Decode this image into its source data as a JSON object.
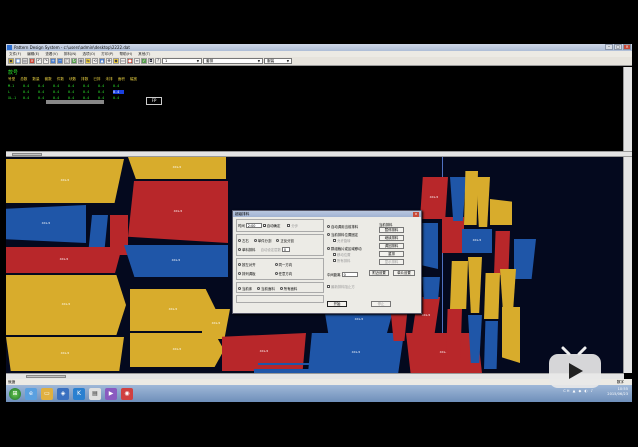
{
  "window": {
    "title": "Pattern Design System - c:\\users\\admin\\desktop\\2222.dat"
  },
  "menu": [
    "文件(F)",
    "编辑(E)",
    "查看(V)",
    "排料(N)",
    "选项(O)",
    "打印(P)",
    "帮助(H)",
    "其他(T)"
  ],
  "toolbar": {
    "page_value": "1",
    "scheme_value": "套排",
    "mode_value": "服装"
  },
  "top_table": {
    "header": "款号",
    "columns": [
      "号型",
      "总数",
      "数量",
      "套数",
      "件数",
      "块数",
      "排数",
      "已排",
      "未排",
      "面积",
      "幅宽"
    ],
    "rows": [
      {
        "label": "M-1",
        "cells": [
          "0-4",
          "0-4",
          "0-4",
          "0-4",
          "0-4",
          "0-4",
          "0-4",
          "",
          "",
          ""
        ]
      },
      {
        "label": "L",
        "cells": [
          "0-4",
          "0-4",
          "0-4",
          "0-4",
          "0-4",
          "0-4",
          "0-4",
          "",
          "",
          ""
        ],
        "selected_index": 6
      },
      {
        "label": "XL-1",
        "cells": [
          "0-4",
          "0-4",
          "0-4",
          "0-4",
          "0-4",
          "0-4",
          "0-4",
          "",
          "",
          ""
        ]
      }
    ],
    "fp_label": "FP"
  },
  "pieces": {
    "label": "XXL-5"
  },
  "dialog": {
    "title": "超级排料",
    "time_label": "时间",
    "time_value": "2:00",
    "auto_confirm": "自动确定",
    "opt_mode": "分步",
    "grp1": [
      "左右",
      "单件分割",
      "正反分割"
    ],
    "grp1b": [
      "单料排料",
      "自动设定层数",
      "0"
    ],
    "grp2": [
      "按左对齐",
      "同一方向",
      "排列调板",
      "任意方向"
    ],
    "grp3": [
      "当前床",
      "当前面料",
      "所有面料"
    ],
    "right_opts": [
      "自动调用当前排料",
      "当前排料位置固定",
      "允许旋转",
      "群组裁片或区域移动",
      "移动位置",
      "所有排料"
    ],
    "percent_label": "中间距离",
    "percent_value": "0",
    "attach_btn": "附近设置",
    "single_btn": "单片设置",
    "side_title": "当前排料",
    "side_buttons": [
      "暂停排料",
      "继续排料",
      "调回排料",
      "重排",
      "显示排料"
    ],
    "unify_label": "最新排料阻止方",
    "start_btn": "开始",
    "stop_btn": "停止"
  },
  "status": {
    "left": "就绪",
    "right": "数字"
  },
  "tray": {
    "icons": "CH ▲ ◆ ◐ ♪",
    "time": "10:55",
    "date": "2015/06/23"
  },
  "colors": {
    "yellow": "#d8ac2c",
    "red": "#b8272a",
    "blue": "#1f56a8",
    "bg": "#04091e"
  }
}
